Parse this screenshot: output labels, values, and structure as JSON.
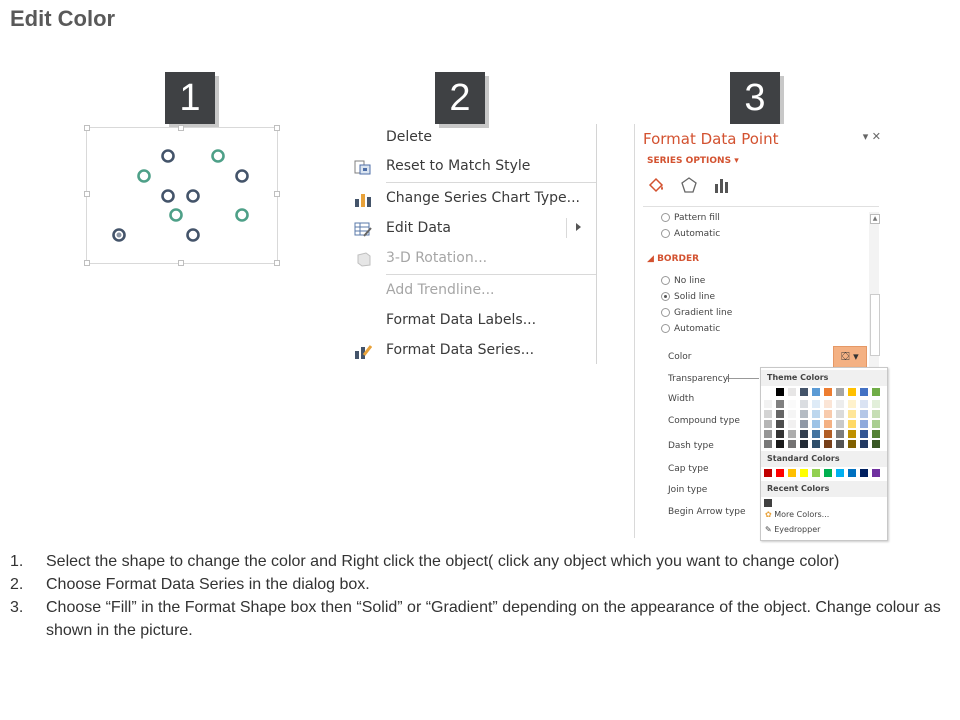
{
  "page": {
    "title": "Edit Color"
  },
  "steps": [
    "1",
    "2",
    "3"
  ],
  "chart": {
    "colors": {
      "dark": "#44546a",
      "teal": "#4ea088"
    }
  },
  "context_menu": {
    "items": [
      {
        "label": "Delete",
        "icon": "none",
        "disabled": false
      },
      {
        "label": "Reset to Match Style",
        "icon": "reset-style-icon",
        "disabled": false
      },
      {
        "label": "Change Series Chart Type...",
        "icon": "bar-chart-icon",
        "disabled": false
      },
      {
        "label": "Edit Data",
        "icon": "edit-data-icon",
        "disabled": false,
        "submenu": true
      },
      {
        "label": "3-D Rotation...",
        "icon": "cube-icon",
        "disabled": true
      },
      {
        "label": "Add Trendline...",
        "icon": "none",
        "disabled": true
      },
      {
        "label": "Format Data Labels...",
        "icon": "none",
        "disabled": false
      },
      {
        "label": "Format Data Series...",
        "icon": "format-series-icon",
        "disabled": false
      }
    ]
  },
  "format_pane": {
    "title": "Format Data Point",
    "series_options": "SERIES OPTIONS",
    "fill_options": [
      "Pattern fill",
      "Automatic"
    ],
    "border_section": "BORDER",
    "border_options": [
      "No line",
      "Solid line",
      "Gradient line",
      "Automatic"
    ],
    "border_selected": 1,
    "properties": [
      "Color",
      "Transparency",
      "Width",
      "Compound type",
      "Dash type",
      "Cap type",
      "Join type",
      "Begin Arrow type"
    ],
    "accent": "#d35230"
  },
  "palette": {
    "theme_colors": "Theme Colors",
    "standard_colors": "Standard Colors",
    "recent_colors": "Recent Colors",
    "more_colors": "More Colors...",
    "eyedropper": "Eyedropper",
    "theme_row": [
      "#ffffff",
      "#000000",
      "#e7e6e6",
      "#44546a",
      "#5b9bd5",
      "#ed7d31",
      "#a5a5a5",
      "#ffc000",
      "#4472c4",
      "#70ad47"
    ],
    "standard_row": [
      "#c00000",
      "#ff0000",
      "#ffc000",
      "#ffff00",
      "#92d050",
      "#00b050",
      "#00b0f0",
      "#0070c0",
      "#002060",
      "#7030a0"
    ],
    "recent": [
      "#404040"
    ]
  },
  "instructions": [
    {
      "num": "1.",
      "text": "Select the shape to change the color and Right click the object( click any object which you want to change color)"
    },
    {
      "num": "2.",
      "text": "Choose Format Data Series in the dialog box."
    },
    {
      "num": "3.",
      "text": "Choose “Fill” in the Format Shape box then “Solid” or “Gradient” depending on the appearance of the object. Change colour as shown in the picture."
    }
  ]
}
